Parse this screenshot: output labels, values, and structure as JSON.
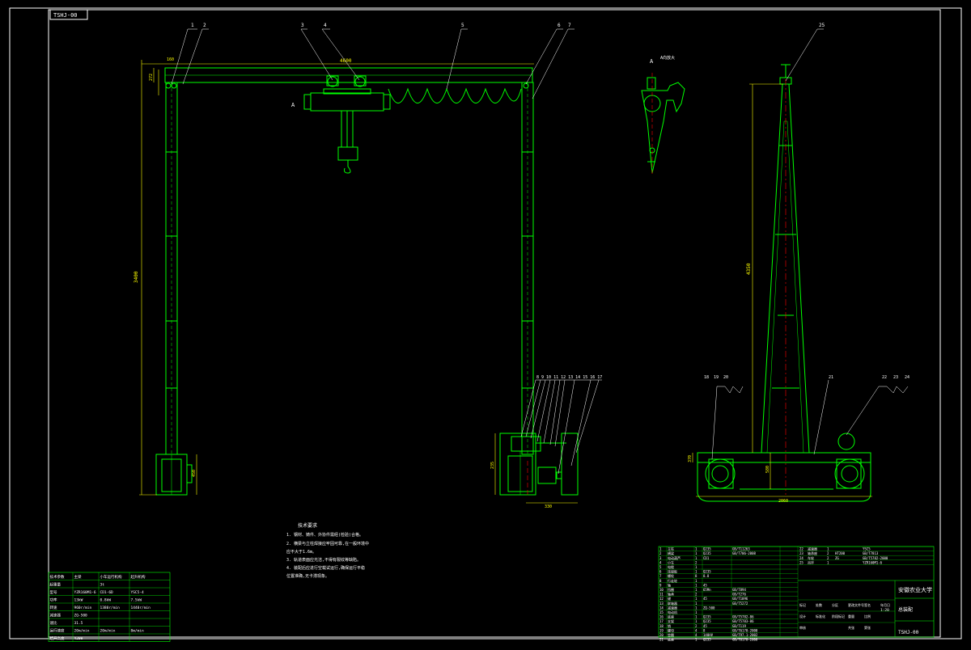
{
  "drawing": {
    "code_box": "TSHJ-00",
    "title_block": {
      "university": "安徽农业大学",
      "drawing_name": "总装配",
      "drawing_code": "TSHJ-00",
      "scale": "1:20"
    }
  },
  "colors": {
    "background": "#000000",
    "frame": "#ffffff",
    "structure": "#00ff00",
    "dimension": "#ffff00",
    "centerline": "#ff0000",
    "table_lines": "#00ff00"
  },
  "dimensions": {
    "top_span": "4600",
    "left_height": "3400",
    "right_height": "4350",
    "base_width": "2060",
    "wheel_base": "330",
    "small_a": "370",
    "small_b": "450",
    "leg_h": "235",
    "base_h": "580",
    "top_a": "160",
    "top_b": "272"
  },
  "views": {
    "detail_label": "A",
    "detail_caption": "A向放大",
    "main_label_a": "A"
  },
  "part_numbers": {
    "top_left": [
      "1",
      "2",
      "3",
      "4",
      "5",
      "6",
      "7"
    ],
    "wheel_group": [
      "8",
      "9",
      "10",
      "11",
      "12",
      "13",
      "14",
      "15",
      "16",
      "17"
    ],
    "side_base": [
      "18",
      "19",
      "20",
      "21",
      "22",
      "23",
      "24"
    ],
    "side_top": "25"
  },
  "notes": {
    "title": "技术要求",
    "lines": [
      "1. 钢材、铸件、外协件需经(检验)合格。",
      "2. 横梁与立柱焊接应牢固可靠,在一般环境中",
      "   应不大于1.6m。",
      "3. 轨道表面应光洁,不得有裂纹等缺陷。",
      "4. 装配后应进行空载试运行,确保运行平稳",
      "   位置准确,无卡滞现象。"
    ]
  },
  "spec_table": {
    "header": [
      "技术参数",
      "主梁",
      "小车运行机构",
      "起升机构"
    ],
    "rows": [
      [
        "起重量",
        "",
        "3t",
        ""
      ],
      [
        "型号",
        "YZR160M1-6",
        "CD1-6D",
        "YSC5-4"
      ],
      [
        "功率",
        "13kW",
        "0.8kW",
        "7.5kW"
      ],
      [
        "转速",
        "960r/min",
        "1380r/min",
        "1440r/min"
      ],
      [
        "减速器",
        "ZQ-500",
        "",
        ""
      ],
      [
        "速比",
        "31.5",
        "",
        ""
      ],
      [
        "运行速度",
        "20m/min",
        "20m/min",
        "8m/min"
      ],
      [
        "起升高度",
        "4200",
        "",
        ""
      ]
    ]
  },
  "parts_table": {
    "rows": [
      [
        "1",
        "立柱",
        "1",
        "Q235",
        "",
        "GB/T11263",
        "",
        ""
      ],
      [
        "2",
        "横梁",
        "1",
        "Q235",
        "",
        "GB/T706-2008",
        "",
        ""
      ],
      [
        "3",
        "电动葫芦",
        "1",
        "CD1",
        "",
        "",
        "",
        ""
      ],
      [
        "4",
        "小车",
        "2",
        "",
        "",
        "",
        "",
        ""
      ],
      [
        "5",
        "电缆",
        "1",
        "",
        "",
        "",
        "",
        ""
      ],
      [
        "6",
        "连接板",
        "1",
        "Q235",
        "",
        "",
        "",
        ""
      ],
      [
        "7",
        "螺栓",
        "8",
        "8.8",
        "",
        "",
        "",
        ""
      ],
      [
        "8",
        "行走轮",
        "1",
        "",
        "",
        "",
        "",
        ""
      ],
      [
        "9",
        "轴",
        "1",
        "45",
        "",
        "",
        "",
        ""
      ],
      [
        "10",
        "挡圈",
        "1",
        "65Mn",
        "",
        "GB/T894",
        "",
        ""
      ],
      [
        "11",
        "轴承",
        "2",
        "",
        "",
        "GB/T276",
        "",
        ""
      ],
      [
        "12",
        "键",
        "1",
        "45",
        "",
        "GB/T1096",
        "",
        ""
      ],
      [
        "13",
        "联轴器",
        "1",
        "",
        "",
        "GB/T5272",
        "",
        ""
      ],
      [
        "14",
        "减速器",
        "1",
        "ZQ-500",
        "",
        "",
        "",
        ""
      ],
      [
        "15",
        "电动机",
        "1",
        "",
        "",
        "",
        "",
        ""
      ],
      [
        "16",
        "底座",
        "1",
        "Q235",
        "",
        "GB/T5782-86",
        "",
        ""
      ],
      [
        "17",
        "支架",
        "1",
        "Q235",
        "",
        "GB/T5783-86",
        "",
        ""
      ],
      [
        "18",
        "销",
        "2",
        "45",
        "",
        "GB/T119",
        "",
        ""
      ],
      [
        "19",
        "螺母",
        "4",
        "8",
        "",
        "GB/T6170-2000",
        "",
        ""
      ],
      [
        "20",
        "垫圈",
        "4",
        "140HV",
        "",
        "GB/T97.1-2002",
        "",
        ""
      ],
      [
        "21",
        "底座",
        "1",
        "Q235",
        "",
        "GB/T6170-2000",
        "",
        ""
      ]
    ],
    "right_rows": [
      [
        "22",
        "减速器",
        "1",
        "",
        "YSC5"
      ],
      [
        "23",
        "轴承座",
        "2",
        "HT200",
        "GB/T7813"
      ],
      [
        "24",
        "车轮",
        "2",
        "ZG",
        "GB/T5782-2000"
      ],
      [
        "25",
        "吊环",
        "1",
        "",
        "YZR160M1-6"
      ]
    ],
    "sign": [
      "标记",
      "处数",
      "分区",
      "更改文件号",
      "签名",
      "年月日"
    ],
    "sign2": [
      "设计",
      "标准化",
      "阶段标记",
      "重量",
      "比例"
    ],
    "sign3": [
      "审核",
      "",
      "",
      "共张",
      "第张"
    ]
  }
}
